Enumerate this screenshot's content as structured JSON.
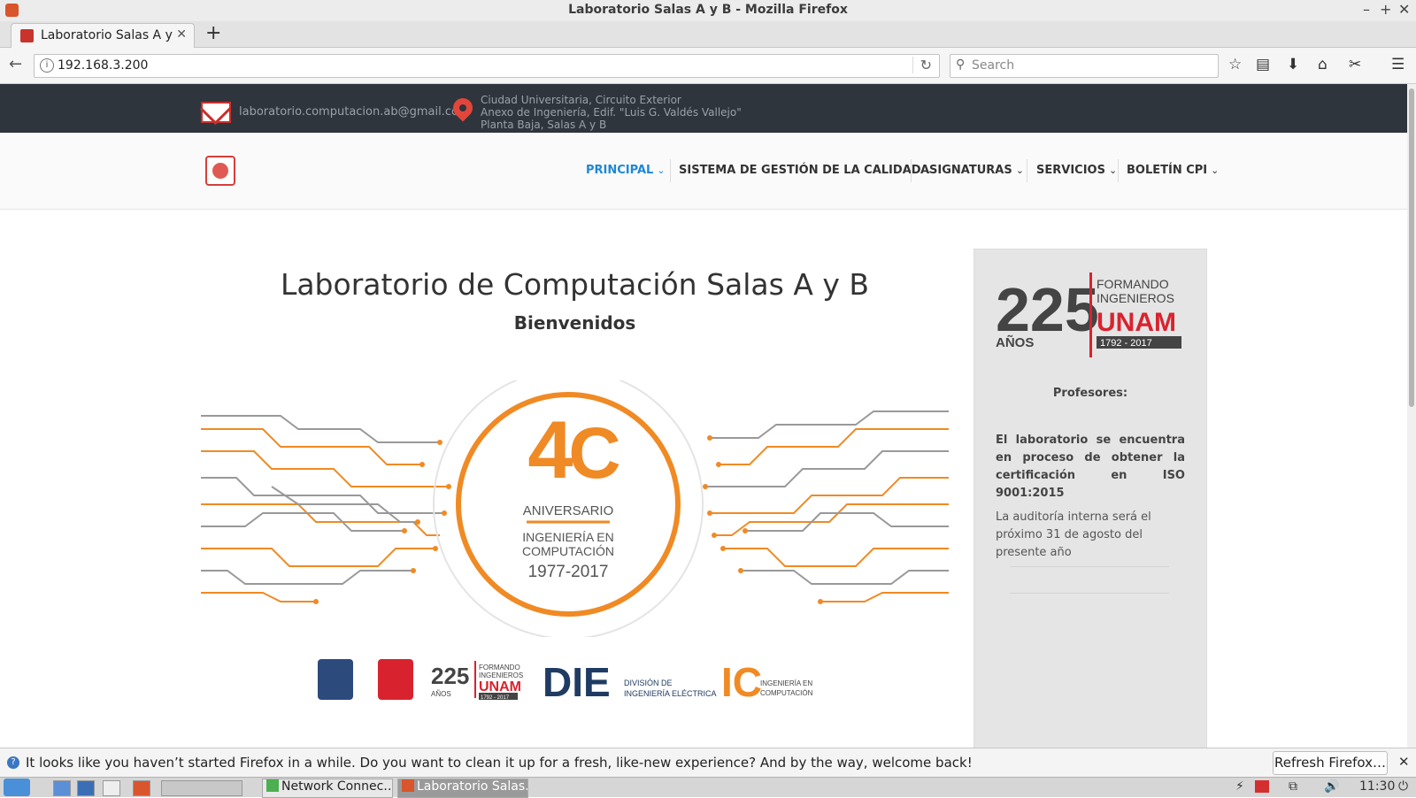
{
  "window": {
    "title": "Laboratorio Salas A y B - Mozilla Firefox",
    "controls": [
      "–",
      "+",
      "✕"
    ]
  },
  "tabs": [
    {
      "label": "Laboratorio Salas A y B"
    }
  ],
  "newtab_label": "+",
  "navbar": {
    "url": "192.168.3.200",
    "search_placeholder": "Search"
  },
  "site": {
    "email": "laboratorio.computacion.ab@gmail.com",
    "address": [
      "Ciudad Universitaria, Circuito Exterior",
      "Anexo de Ingeniería, Edif. \"Luis G. Valdés Vallejo\"",
      "Planta Baja, Salas A y B"
    ],
    "menu": [
      "PRINCIPAL",
      "SISTEMA DE GESTIÓN DE LA CALIDAD",
      "ASIGNATURAS",
      "SERVICIOS",
      "BOLETÍN CPI"
    ],
    "title": "Laboratorio de Computación Salas A y B",
    "subtitle": "Bienvenidos",
    "banner": {
      "number_left": "4",
      "number_right": "C",
      "line1": "ANIVERSARIO",
      "line2": "INGENIERÍA EN",
      "line3": "COMPUTACIÓN",
      "years": "1977-2017"
    },
    "logos": {
      "unam_years": "225",
      "anos": "AÑOS",
      "formando": "FORMANDO",
      "ingenieros": "INGENIEROS",
      "unam": "UNAM",
      "range": "1792 - 2017",
      "die": "DIE",
      "die_text1": "DIVISIÓN DE",
      "die_text2": "INGENIERÍA ELÉCTRICA",
      "ic": "IC",
      "ic_text1": "INGENIERÍA EN",
      "ic_text2": "COMPUTACIÓN"
    },
    "sidebar": {
      "profesores": "Profesores:",
      "iso": "El laboratorio se encuentra en proceso de obtener la certificación en ISO 9001:2015",
      "audit": "La auditoría interna será el próximo 31 de agosto del presente año"
    }
  },
  "notification": {
    "message": "It looks like you haven’t started Firefox in a while. Do you want to clean it up for a fresh, like-new experience? And by the way, welcome back!",
    "button": "Refresh Firefox…"
  },
  "taskbar": {
    "tasks": [
      "Network Connec…",
      "Laboratorio Salas…"
    ],
    "clock": "11:30"
  },
  "colors": {
    "orange": "#f08a24",
    "red": "#d8232e",
    "navy": "#1f3b63",
    "dark_strip": "#2f353d"
  }
}
